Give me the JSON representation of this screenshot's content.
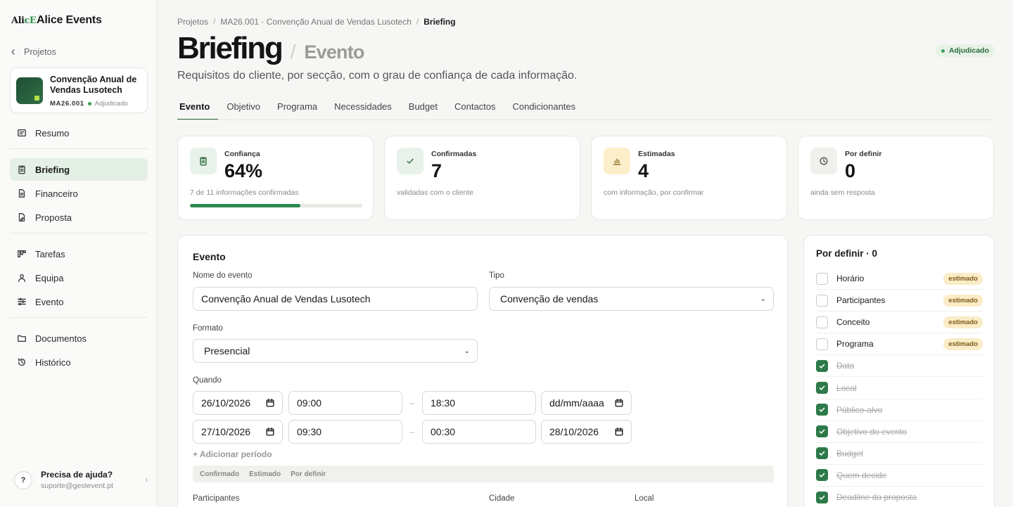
{
  "app": {
    "logo_text_1": "Ali",
    "logo_text_2": "cE",
    "name": "Alice Events"
  },
  "sidebar": {
    "back_label": "Projetos",
    "project": {
      "title": "Convenção Anual de Vendas Lusotech",
      "code": "MA26.001",
      "status": "Adjudicado"
    },
    "groups": [
      [
        {
          "label": "Resumo",
          "icon": "summary-icon"
        }
      ],
      [
        {
          "label": "Briefing",
          "icon": "clipboard-icon",
          "active": true
        },
        {
          "label": "Financeiro",
          "icon": "file-icon"
        },
        {
          "label": "Proposta",
          "icon": "file-edit-icon"
        }
      ],
      [
        {
          "label": "Tarefas",
          "icon": "kanban-icon"
        },
        {
          "label": "Equipa",
          "icon": "users-icon"
        },
        {
          "label": "Evento",
          "icon": "sliders-icon"
        }
      ],
      [
        {
          "label": "Documentos",
          "icon": "folder-icon"
        },
        {
          "label": "Histórico",
          "icon": "history-icon"
        }
      ]
    ],
    "help": {
      "badge": "?",
      "title": "Precisa de ajuda?",
      "email": "suporte@gestevent.pt",
      "chevron": "›"
    }
  },
  "breadcrumb": {
    "items": [
      "Projetos",
      "MA26.001 · Convenção Anual de Vendas Lusotech"
    ],
    "current": "Briefing",
    "sep": "/"
  },
  "header": {
    "title": "Briefing",
    "slash": "/",
    "section": "Evento",
    "status": "Adjudicado",
    "subtitle": "Requisitos do cliente, por secção, com o grau de confiança de cada informação."
  },
  "tabs": [
    "Evento",
    "Objetivo",
    "Programa",
    "Necessidades",
    "Budget",
    "Contactos",
    "Condicionantes"
  ],
  "stats": [
    {
      "label": "Confiança",
      "value": "64%",
      "note": "7 de 11 informações confirmadas",
      "progress_percent": 64,
      "icon": "clipboard-icon",
      "icon_bg": "#e8f2ea",
      "icon_color": "#2d6a3c"
    },
    {
      "label": "Confirmadas",
      "value": "7",
      "note": "validadas com o cliente",
      "icon": "check-icon",
      "icon_bg": "#e8f2ea",
      "icon_color": "#2d6a3c"
    },
    {
      "label": "Estimadas",
      "value": "4",
      "note": "com informação, por confirmar",
      "icon": "bar-chart-icon",
      "icon_bg": "#fbeec9",
      "icon_color": "#8a6a1e"
    },
    {
      "label": "Por definir",
      "value": "0",
      "note": "ainda sem resposta",
      "icon": "clock-icon",
      "icon_bg": "#f0f0ed",
      "icon_color": "#555555"
    }
  ],
  "form": {
    "title": "Evento",
    "name_label": "Nome do evento",
    "name_value": "Convenção Anual de Vendas Lusotech",
    "type_label": "Tipo",
    "type_value": "Convenção de vendas",
    "format_label": "Formato",
    "format_value": "Presencial",
    "when_label": "Quando",
    "periods": [
      {
        "start_date": "26/10/2026",
        "start_time": "09:00",
        "end_time": "18:30",
        "end_date": "dd/mm/aaaa"
      },
      {
        "start_date": "27/10/2026",
        "start_time": "09:30",
        "end_time": "00:30",
        "end_date": "28/10/2026"
      }
    ],
    "dash": "–",
    "add_period": "+ Adicionar período",
    "confidence_options": [
      "Confirmado",
      "Estimado",
      "Por definir"
    ],
    "participants_label": "Participantes",
    "city_label": "Cidade",
    "place_label": "Local"
  },
  "todo": {
    "title": "Por definir · 0",
    "items": [
      {
        "label": "Horário",
        "checked": false,
        "chip": "estimado"
      },
      {
        "label": "Participantes",
        "checked": false,
        "chip": "estimado"
      },
      {
        "label": "Conceito",
        "checked": false,
        "chip": "estimado"
      },
      {
        "label": "Programa",
        "checked": false,
        "chip": "estimado"
      },
      {
        "label": "Data",
        "checked": true
      },
      {
        "label": "Local",
        "checked": true
      },
      {
        "label": "Público-alvo",
        "checked": true
      },
      {
        "label": "Objetivo do evento",
        "checked": true
      },
      {
        "label": "Budget",
        "checked": true
      },
      {
        "label": "Quem decide",
        "checked": true
      },
      {
        "label": "Deadline da proposta",
        "checked": true
      }
    ]
  }
}
